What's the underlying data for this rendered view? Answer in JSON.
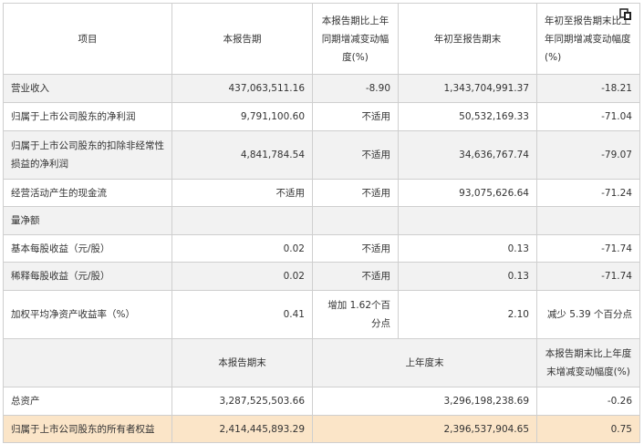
{
  "header": {
    "item": "项目",
    "current": "本报告期",
    "current_yoy": "本报告期比上年同期增减变动幅度(%)",
    "ytd": "年初至报告期末",
    "ytd_yoy": "年初至报告期末比上年同期增减变动幅度(%)"
  },
  "rows": [
    {
      "label": "营业收入",
      "current": "437,063,511.16",
      "yoy": "-8.90",
      "ytd": "1,343,704,991.37",
      "ytd_yoy": "-18.21"
    },
    {
      "label": "归属于上市公司股东的净利润",
      "current": "9,791,100.60",
      "yoy": "不适用",
      "ytd": "50,532,169.33",
      "ytd_yoy": "-71.04"
    },
    {
      "label": "归属于上市公司股东的扣除非经常性损益的净利润",
      "current": "4,841,784.54",
      "yoy": "不适用",
      "ytd": "34,636,767.74",
      "ytd_yoy": "-79.07"
    },
    {
      "label": "经营活动产生的现金流",
      "current": "不适用",
      "yoy": "不适用",
      "ytd": "93,075,626.64",
      "ytd_yoy": "-71.24"
    },
    {
      "label": "量净额",
      "current": "",
      "yoy": "",
      "ytd": "",
      "ytd_yoy": ""
    },
    {
      "label": "基本每股收益（元/股）",
      "current": "0.02",
      "yoy": "不适用",
      "ytd": "0.13",
      "ytd_yoy": "-71.74"
    },
    {
      "label": "稀释每股收益（元/股）",
      "current": "0.02",
      "yoy": "不适用",
      "ytd": "0.13",
      "ytd_yoy": "-71.74"
    },
    {
      "label": "加权平均净资产收益率（%）",
      "current": "0.41",
      "yoy": "增加 1.62个百分点",
      "ytd": "2.10",
      "ytd_yoy": "减少 5.39 个百分点"
    }
  ],
  "header2": {
    "period_end": "本报告期末",
    "prev_year_end": "上年度末",
    "change": "本报告期末比上年度末增减变动幅度(%)"
  },
  "rows2": [
    {
      "label": "总资产",
      "period_end": "3,287,525,503.66",
      "prev_year_end": "3,296,198,238.69",
      "change": "-0.26"
    },
    {
      "label": "归属于上市公司股东的所有者权益",
      "period_end": "2,414,445,893.29",
      "prev_year_end": "2,396,537,904.65",
      "change": "0.75"
    }
  ],
  "icons": {
    "copy": "copy-icon"
  }
}
